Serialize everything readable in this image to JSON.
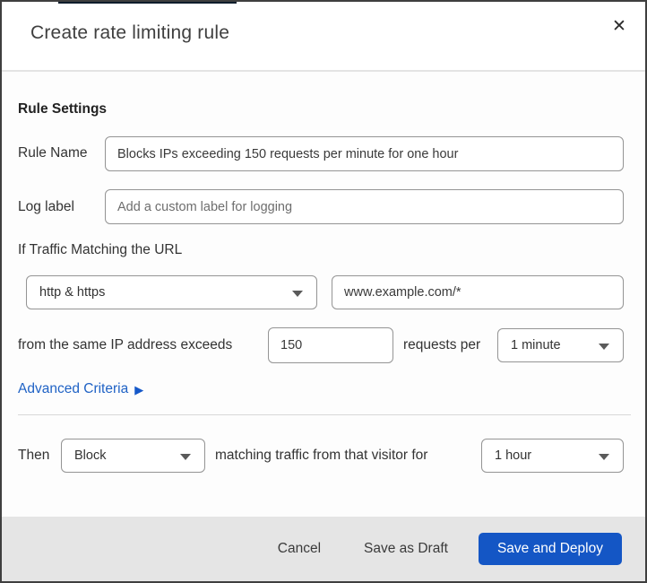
{
  "dialog": {
    "title": "Create rate limiting rule",
    "close_icon": "✕",
    "top_strip_color": "#0e1d2c"
  },
  "colors": {
    "primary_button": "#1456c5",
    "link_blue": "#1f62c5",
    "footer_bg": "#e5e5e5",
    "input_border": "#949494"
  },
  "rule_settings": {
    "heading": "Rule Settings",
    "rule_name": {
      "label": "Rule Name",
      "value": "Blocks IPs exceeding 150 requests per minute for one hour"
    },
    "log_label": {
      "label": "Log label",
      "placeholder": "Add a custom label for logging"
    }
  },
  "match": {
    "intro": "If Traffic Matching the URL",
    "scheme_select": {
      "value": "http & https"
    },
    "url_input": {
      "value": "www.example.com/*"
    },
    "threshold": {
      "prefix": "from the same IP address exceeds",
      "count_value": "150",
      "middle": "requests per",
      "period_select": {
        "value": "1 minute"
      }
    },
    "advanced_link": {
      "label": "Advanced Criteria",
      "arrow_icon": "▶"
    }
  },
  "action": {
    "then_label": "Then",
    "action_select": {
      "value": "Block"
    },
    "middle": "matching traffic from that visitor for",
    "duration_select": {
      "value": "1 hour"
    }
  },
  "footer": {
    "cancel": "Cancel",
    "save_draft": "Save as Draft",
    "save_deploy": "Save and Deploy"
  }
}
